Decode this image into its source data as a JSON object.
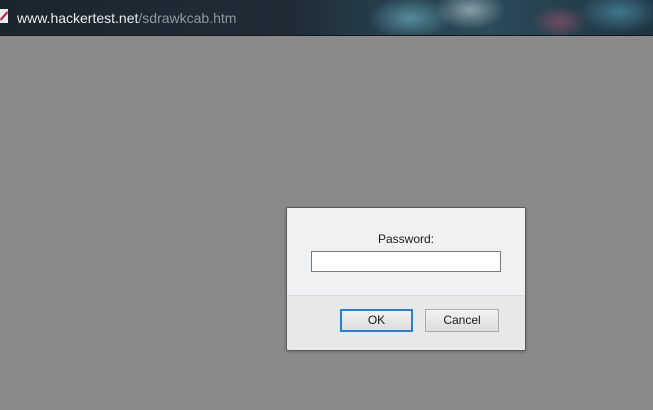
{
  "browser": {
    "url_host": "www.hackertest.net",
    "url_path": "/sdrawkcab.htm"
  },
  "dialog": {
    "label": "Password:",
    "input_value": "",
    "ok_label": "OK",
    "cancel_label": "Cancel"
  },
  "colors": {
    "page_background": "#8a8a8a",
    "dialog_background": "#eef0f3",
    "ok_focus_border": "#2f7fc8"
  },
  "icons": {
    "site_icon": "favicon-icon"
  }
}
